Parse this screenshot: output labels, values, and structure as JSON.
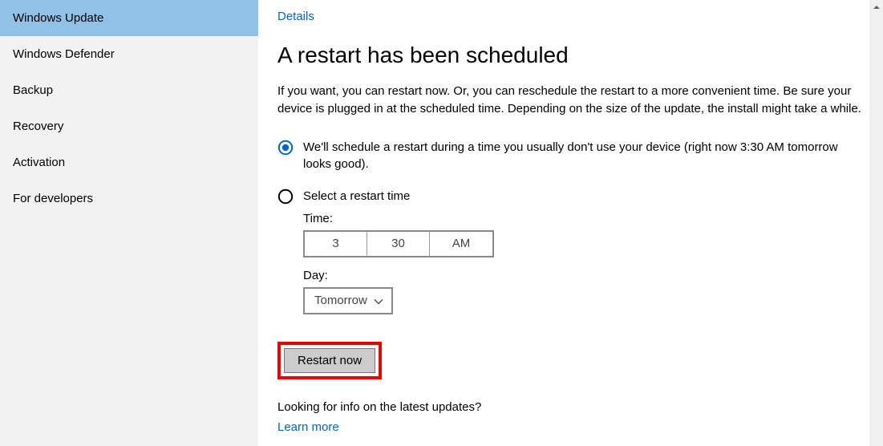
{
  "sidebar": {
    "items": [
      {
        "label": "Windows Update",
        "selected": true
      },
      {
        "label": "Windows Defender",
        "selected": false
      },
      {
        "label": "Backup",
        "selected": false
      },
      {
        "label": "Recovery",
        "selected": false
      },
      {
        "label": "Activation",
        "selected": false
      },
      {
        "label": "For developers",
        "selected": false
      }
    ]
  },
  "main": {
    "details_link": "Details",
    "heading": "A restart has been scheduled",
    "description": "If you want, you can restart now. Or, you can reschedule the restart to a more convenient time. Be sure your device is plugged in at the scheduled time. Depending on the size of the update, the install might take a while.",
    "options": {
      "auto": {
        "label": "We'll schedule a restart during a time you usually don't use your device (right now 3:30 AM tomorrow looks good).",
        "checked": true
      },
      "manual": {
        "label": "Select a restart time",
        "checked": false,
        "time_label": "Time:",
        "hour": "3",
        "minute": "30",
        "ampm": "AM",
        "day_label": "Day:",
        "day_value": "Tomorrow"
      }
    },
    "restart_button": "Restart now",
    "more_text": "Looking for info on the latest updates?",
    "learn_link": "Learn more"
  }
}
